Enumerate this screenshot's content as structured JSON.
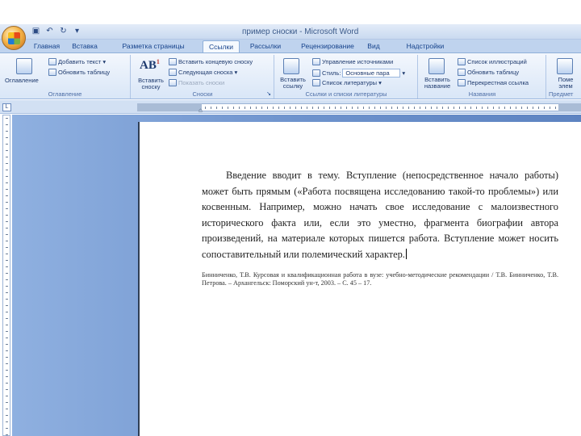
{
  "window": {
    "title": "пример сноски - Microsoft Word"
  },
  "icons": {
    "office": "office-button-icon",
    "save": "save-icon",
    "undo": "undo-icon",
    "redo": "redo-icon",
    "qat_menu": "quick-access-dropdown-icon"
  },
  "tabs": [
    "Главная",
    "Вставка",
    "Разметка страницы",
    "Ссылки",
    "Рассылки",
    "Рецензирование",
    "Вид",
    "Надстройки"
  ],
  "active_tab": "Ссылки",
  "ribbon": {
    "toc": {
      "big_button": "Оглавление",
      "add_text": "Добавить текст",
      "update_table": "Обновить таблицу",
      "label": "Оглавление"
    },
    "footnotes": {
      "big_button": "Вставить сноску",
      "ab_glyph": "AB",
      "ab_sup": "1",
      "insert_endnote": "Вставить концевую сноску",
      "next_footnote": "Следующая сноска",
      "show_notes": "Показать сноски",
      "label": "Сноски"
    },
    "citations": {
      "big_button": "Вставить ссылку",
      "manage_sources": "Управление источниками",
      "style_label": "Стиль:",
      "style_value": "Основные пара",
      "bibliography": "Список литературы",
      "label": "Ссылки и списки литературы"
    },
    "captions": {
      "big_button": "Вставить название",
      "table_of_figures": "Список иллюстраций",
      "update_table": "Обновить таблицу",
      "cross_reference": "Перекрестная ссылка",
      "label": "Названия"
    },
    "index": {
      "big_button": "Поме элем",
      "label": "Предмет"
    }
  },
  "document": {
    "paragraph": "Введение вводит в тему. Вступление (непосредственное начало работы) может быть прямым («Работа посвящена исследованию такой-то проблемы») или косвенным. Например, можно начать свое исследование с малоизвестного исторического факта или, если это уместно, фрагмента биографии автора произведений, на материале которых пишется работа. Вступление может носить сопоставительный или полемический характер.",
    "footnote": "Бинниченко, Т.В. Курсовая и квалификационная работа в вузе: учебно-методические рекомендации / Т.В. Бинниченко, Т.В. Петрова. – Архангельск: Поморский ун-т, 2003. – С. 45 – 17."
  },
  "colors": {
    "ribbon_bg": "#dce8f8",
    "workspace_bg": "#6e93cd",
    "text": "#15428b"
  }
}
